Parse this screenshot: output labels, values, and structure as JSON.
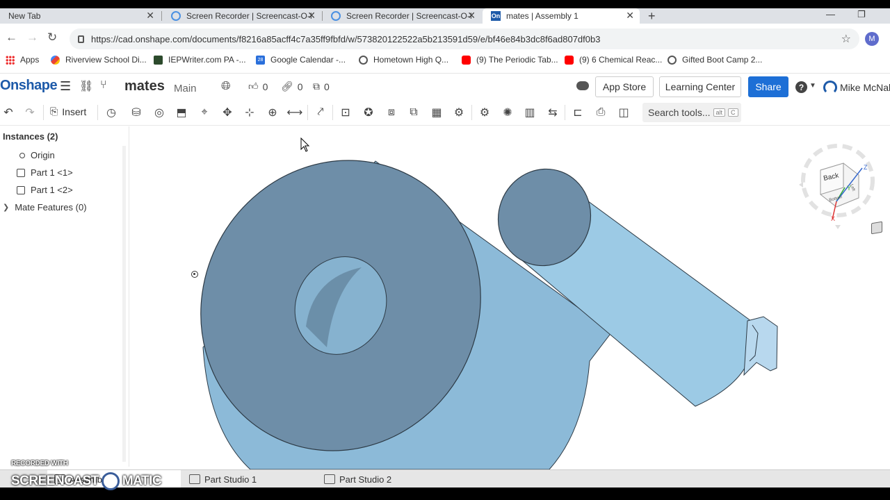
{
  "browser": {
    "tabs": [
      {
        "title": "New Tab"
      },
      {
        "title": "Screen Recorder | Screencast-O-M"
      },
      {
        "title": "Screen Recorder | Screencast-O-M"
      },
      {
        "title": "mates | Assembly 1",
        "favicon": "On"
      }
    ],
    "url": "https://cad.onshape.com/documents/f8216a85acff4c7a35ff9fbfd/w/573820122522a5b213591d59/e/bf46e84b3dc8f6ad807df0b3",
    "profile_initial": "M",
    "bookmarks": [
      "Apps",
      "Riverview School Di...",
      "IEPWriter.com PA -...",
      "Google Calendar -...",
      "Hometown High Q...",
      "(9) The Periodic Tab...",
      "(9) 6 Chemical Reac...",
      "Gifted Boot Camp 2..."
    ],
    "calendar_icon_text": "28"
  },
  "onshape": {
    "logo": "Onshape",
    "doc_name": "mates",
    "branch": "Main",
    "likes": "0",
    "links": "0",
    "copies": "0",
    "buttons": {
      "app_store": "App Store",
      "learning_center": "Learning Center",
      "share": "Share"
    },
    "help_glyph": "?",
    "user_name": "Mike McNally",
    "accent": "#1d6fd6",
    "brand": "#1d5aa9"
  },
  "toolbar": {
    "insert": "Insert",
    "search_tools": "Search tools...",
    "shortcut_alt": "alt",
    "shortcut_key": "C"
  },
  "left_panel": {
    "instances_header": "Instances (2)",
    "items": [
      "Origin",
      "Part 1 <1>",
      "Part 1 <2>"
    ],
    "mate_features": "Mate Features (0)"
  },
  "viewcube": {
    "face_back": "Back",
    "face_bottom": "Bottom",
    "face_left": "Left",
    "axis_x": "X",
    "axis_y": "Y",
    "axis_z": "Z"
  },
  "bottom_tabs": [
    "Assembly 1",
    "Part Studio 1",
    "Part Studio 2"
  ],
  "watermark": {
    "recorded_with": "RECORDED WITH",
    "screencast_left": "SCREENCAST",
    "screencast_right": "MATIC"
  },
  "model_colors": {
    "face_dark": "#6a8aa3",
    "face_light": "#9cc6e2",
    "face_mid": "#85b0cc"
  }
}
